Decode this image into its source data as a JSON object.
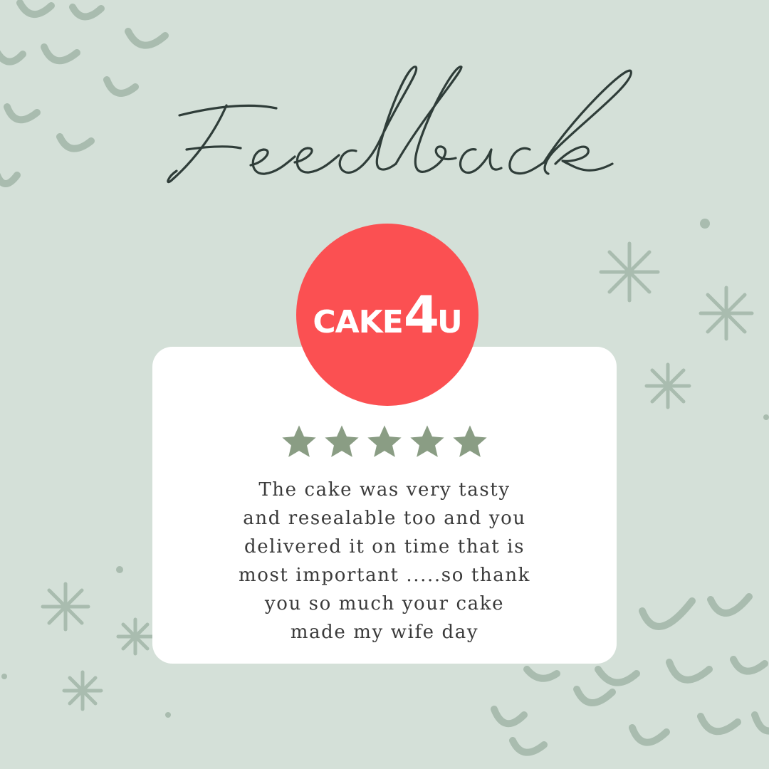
{
  "title": "Feedback",
  "brand": {
    "prefix": "CAKE",
    "four": "4",
    "suffix": "U"
  },
  "rating": {
    "value": 5,
    "max": 5
  },
  "review": "The cake was very tasty\nand resealable too and you\ndelivered it on time that is\nmost important  .....so thank\nyou so much your cake\nmade my wife day",
  "colors": {
    "background": "#d4e0d8",
    "decoration": "#a9bcaf",
    "title": "#2f3d39",
    "logo": "#fb5052",
    "star": "#8a9d84",
    "card": "#ffffff"
  }
}
